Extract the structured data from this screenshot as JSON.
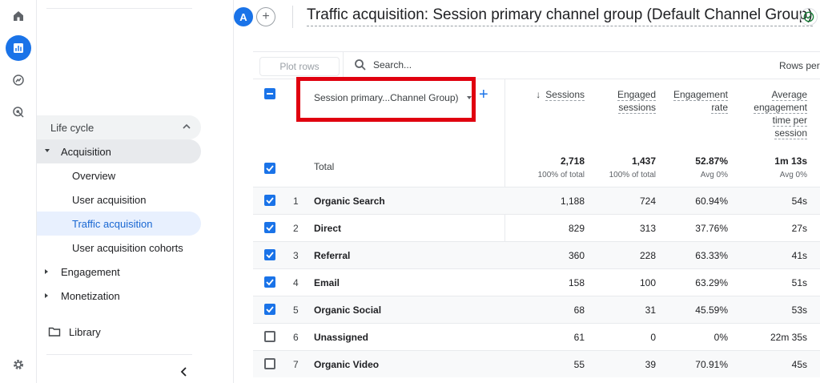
{
  "rail": {
    "icons": [
      "home-icon",
      "reports-icon",
      "explore-icon",
      "advertising-icon",
      "settings-icon"
    ]
  },
  "sidebar": {
    "lifecycle_label": "Life cycle",
    "acquisition": {
      "label": "Acquisition",
      "items": [
        {
          "label": "Overview"
        },
        {
          "label": "User acquisition"
        },
        {
          "label": "Traffic acquisition"
        },
        {
          "label": "User acquisition cohorts"
        }
      ]
    },
    "engagement_label": "Engagement",
    "monetization_label": "Monetization",
    "library_label": "Library"
  },
  "header": {
    "avatar_letter": "A",
    "add_symbol": "+",
    "title": "Traffic acquisition: Session primary channel group (Default Channel Group)"
  },
  "toolbar": {
    "plot_rows": "Plot rows",
    "search_placeholder": "Search...",
    "rows_per_page": "Rows per p"
  },
  "table": {
    "dimension_label": "Session primary...Channel Group)",
    "add_dimension": "+",
    "headers": {
      "sessions": "Sessions",
      "sort_arrow": "↓",
      "engaged_1": "Engaged",
      "engaged_2": "sessions",
      "engagement_rate_1": "Engagement",
      "engagement_rate_2": "rate",
      "avg_1": "Average",
      "avg_2": "engagement",
      "avg_3": "time per",
      "avg_4": "session"
    },
    "total": {
      "label": "Total",
      "sessions": "2,718",
      "sessions_sub": "100% of total",
      "engaged": "1,437",
      "engaged_sub": "100% of total",
      "rate": "52.87%",
      "rate_sub": "Avg 0%",
      "avg_time": "1m 13s",
      "avg_time_sub": "Avg 0%"
    },
    "rows": [
      {
        "num": "1",
        "channel": "Organic Search",
        "sessions": "1,188",
        "engaged": "724",
        "rate": "60.94%",
        "time": "54s",
        "checked": true
      },
      {
        "num": "2",
        "channel": "Direct",
        "sessions": "829",
        "engaged": "313",
        "rate": "37.76%",
        "time": "27s",
        "checked": true
      },
      {
        "num": "3",
        "channel": "Referral",
        "sessions": "360",
        "engaged": "228",
        "rate": "63.33%",
        "time": "41s",
        "checked": true
      },
      {
        "num": "4",
        "channel": "Email",
        "sessions": "158",
        "engaged": "100",
        "rate": "63.29%",
        "time": "51s",
        "checked": true
      },
      {
        "num": "5",
        "channel": "Organic Social",
        "sessions": "68",
        "engaged": "31",
        "rate": "45.59%",
        "time": "53s",
        "checked": true
      },
      {
        "num": "6",
        "channel": "Unassigned",
        "sessions": "61",
        "engaged": "0",
        "rate": "0%",
        "time": "22m 35s",
        "checked": false
      },
      {
        "num": "7",
        "channel": "Organic Video",
        "sessions": "55",
        "engaged": "39",
        "rate": "70.91%",
        "time": "45s",
        "checked": false
      }
    ]
  },
  "colors": {
    "accent": "#1a73e8",
    "highlight": "#e0000f",
    "selected_bg": "#e8f0fe"
  }
}
